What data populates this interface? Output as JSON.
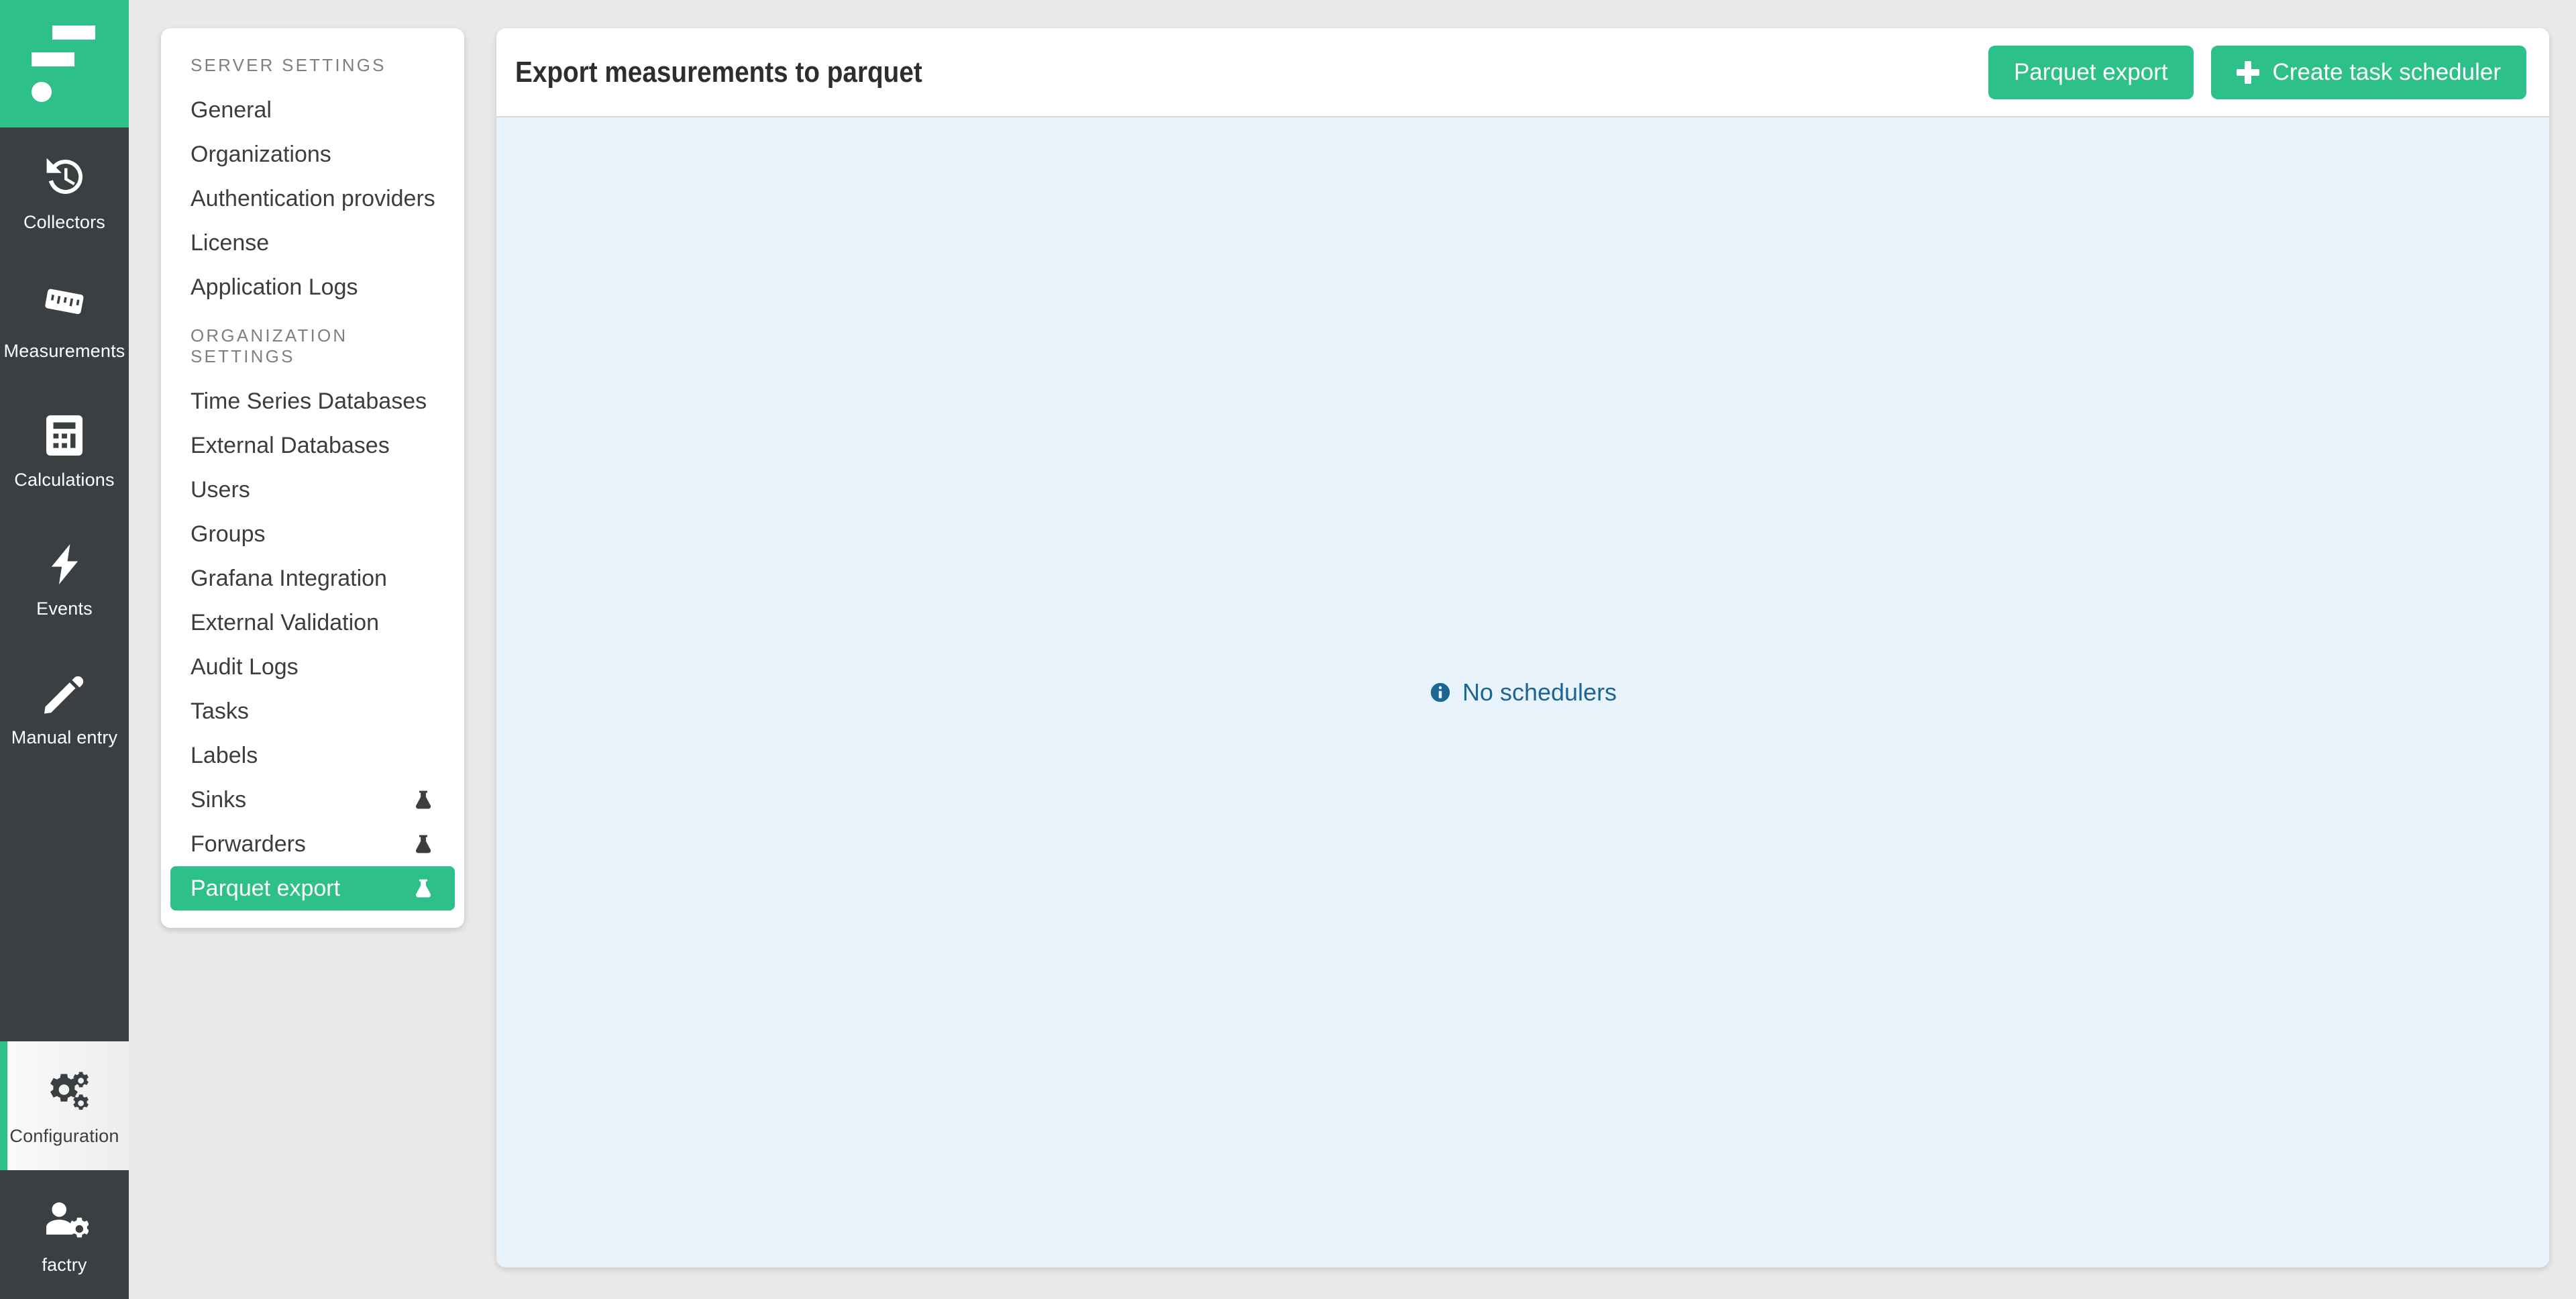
{
  "brand": {
    "name": "factry",
    "accent": "#2ec08a",
    "rail_bg": "#3a4042"
  },
  "rail": {
    "items": [
      {
        "label": "Collectors",
        "icon": "history-restore-icon",
        "active": false
      },
      {
        "label": "Measurements",
        "icon": "ruler-icon",
        "active": false
      },
      {
        "label": "Calculations",
        "icon": "calculator-icon",
        "active": false
      },
      {
        "label": "Events",
        "icon": "lightning-bolt-icon",
        "active": false
      },
      {
        "label": "Manual entry",
        "icon": "pen-write-icon",
        "active": false
      },
      {
        "label": "Configuration",
        "icon": "gears-icon",
        "active": true
      },
      {
        "label": "factry",
        "icon": "user-settings-icon",
        "active": false
      }
    ]
  },
  "settings_menu": {
    "sections": [
      {
        "header": "SERVER SETTINGS",
        "items": [
          {
            "label": "General",
            "badge": null,
            "selected": false
          },
          {
            "label": "Organizations",
            "badge": null,
            "selected": false
          },
          {
            "label": "Authentication providers",
            "badge": null,
            "selected": false
          },
          {
            "label": "License",
            "badge": null,
            "selected": false
          },
          {
            "label": "Application Logs",
            "badge": null,
            "selected": false
          }
        ]
      },
      {
        "header": "ORGANIZATION SETTINGS",
        "items": [
          {
            "label": "Time Series Databases",
            "badge": null,
            "selected": false
          },
          {
            "label": "External Databases",
            "badge": null,
            "selected": false
          },
          {
            "label": "Users",
            "badge": null,
            "selected": false
          },
          {
            "label": "Groups",
            "badge": null,
            "selected": false
          },
          {
            "label": "Grafana Integration",
            "badge": null,
            "selected": false
          },
          {
            "label": "External Validation",
            "badge": null,
            "selected": false
          },
          {
            "label": "Audit Logs",
            "badge": null,
            "selected": false
          },
          {
            "label": "Tasks",
            "badge": null,
            "selected": false
          },
          {
            "label": "Labels",
            "badge": null,
            "selected": false
          },
          {
            "label": "Sinks",
            "badge": "flask-icon",
            "selected": false
          },
          {
            "label": "Forwarders",
            "badge": "flask-icon",
            "selected": false
          },
          {
            "label": "Parquet export",
            "badge": "flask-icon",
            "selected": true
          }
        ]
      }
    ]
  },
  "main": {
    "title": "Export measurements to parquet",
    "actions": [
      {
        "label": "Parquet export",
        "icon": null
      },
      {
        "label": "Create task scheduler",
        "icon": "plus-icon"
      }
    ],
    "empty_state": {
      "icon": "info-circle-icon",
      "text": "No schedulers",
      "color": "#1d6593"
    }
  }
}
